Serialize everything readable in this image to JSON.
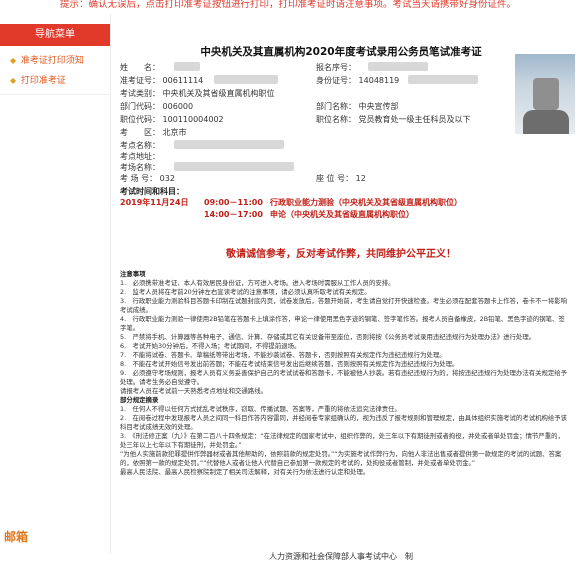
{
  "topbar": {
    "text": "提示：确认无误后，点击打印准考证按钮进行打印，打印准考证时请注意事项。考试当天请携带好身份证件。"
  },
  "sidebar": {
    "header": "导航菜单",
    "items": [
      {
        "label": "准考证打印须知"
      },
      {
        "label": "打印准考证"
      }
    ],
    "footer": "邮箱"
  },
  "ticket": {
    "title": "中央机关及其直属机构2020年度考试录用公务员笔试准考证",
    "name_label": "姓　　名：",
    "regno_label": "报名序号：",
    "examno_label": "准考证号：",
    "examno_value": "00611114",
    "idno_label": "身份证号：",
    "idno_value": "14048119",
    "category_label": "考试类别：",
    "category_value": "中央机关及其省级直属机构职位",
    "deptcode_label": "部门代码：",
    "deptcode_value": "006000",
    "deptname_label": "部门名称：",
    "deptname_value": "中央宣传部",
    "poscode_label": "职位代码：",
    "poscode_value": "100110004002",
    "posname_label": "职位名称：",
    "posname_value": "党员教育处一级主任科员及以下",
    "region_label": "考　　区：",
    "region_value": "北京市",
    "site_label": "考点名称：",
    "addr_label": "考点地址：",
    "school_label": "考场名称：",
    "room_label": "考 场 号：",
    "room_value": "032",
    "seat_label": "座 位 号：",
    "seat_value": "12",
    "schedule_header": "考试时间和科目：",
    "schedule": [
      {
        "date": "2019年11月24日",
        "time": "09:00－11:00",
        "subject": "行政职业能力测验（中央机关及其省级直属机构职位）"
      },
      {
        "date": "",
        "time": "14:00－17:00",
        "subject": "申论（中央机关及其省级直属机构职位）"
      }
    ],
    "slogan": "敬请诚信参考，反对考试作弊，共同维护公平正义！"
  },
  "notes": {
    "heading": "注意事项",
    "lines": [
      "1.　必须携带准考证、本人有效居民身份证，方可进入考场。进入考场时需服从工作人员的安排。",
      "2.　监考人员将在考前20分钟左右宣读考试的注意事项，请必须认真听取考试有关规定。",
      "3.　行政职业能力测验科目答题卡印制在试题封底内页，试卷发放后，答题开始前，考生请自觉打开快速检查。考生必须在配套答题卡上作答，卷卡不一将影响考试成绩。",
      "4.　行政职业能力测验一律使用2B铅笔在答题卡上填涂作答，申论一律使用黑色字迹的钢笔、签字笔作答。报考人员自备橡皮，2B铅笔、黑色字迹的钢笔、签字笔。",
      "5.　严禁将手机、计算器等各种电子、通信、计算、存储或其它有关设备带至座位，否则将按《公务员考试录用违纪违规行为处理办法》进行处理。",
      "6.　考试开始30分钟后，不得入场；考试期间，不得提前退场。",
      "7.　不能将试卷、答题卡、草稿纸等带出考场，不能抄袭试卷、答题卡，否则按照有关规定作为违纪违规行为处理。",
      "8.　不能在考试开始信号发出前答题；不能在考试结束信号发出后继续答题，否则按照有关规定作为违纪违规行为处理。",
      "9.　必须遵守考场规则，报考人员有义务妥善保护自己的考试试卷和答题卡，不能被他人抄袭。若有违纪违规行为的，将按违纪违规行为处理办法有关规定给予处理。请考生务必自觉遵守。",
      "请报考人员在考试前一天熟悉考点地址和交通路线。",
      "部分规定摘录",
      "1.　任何人不得以任何方式扰乱考试秩序，窃取、传播试题、答案等，严重的将依法追究法律责任。",
      "2.　在阅卷过程中发现报考人员之间同一科目作答内容雷同，并经阅卷专家组确认的，视为违反了报考规则和管理规定，由具体组织实施考试的考试机构给予该科目考试成绩无效的处理。",
      "3.　《刑法修正案（九）》在第二百八十四条规定：“在法律规定的国家考试中，组织作弊的，处三年以下有期徒刑或者拘役，并处或者单处罚金；情节严重的，处三年以上七年以下有期徒刑，并处罚金。”",
      "“为他人实施前款犯罪提供作弊器材或者其他帮助的，依照前款的规定处罚。”“为实施考试作弊行为，向他人非法出售或者提供第一款规定的考试的试题、答案的，依照第一款的规定处罚。”“代替他人或者让他人代替自己参加第一款规定的考试的，处拘役或者管制，并处或者单处罚金。”",
      "最高人民法院、最高人民检察院制定了相关司法解释，对有关行为依法进行认定和处理。"
    ]
  },
  "footer": "人力资源和社会保障部人事考试中心　制"
}
